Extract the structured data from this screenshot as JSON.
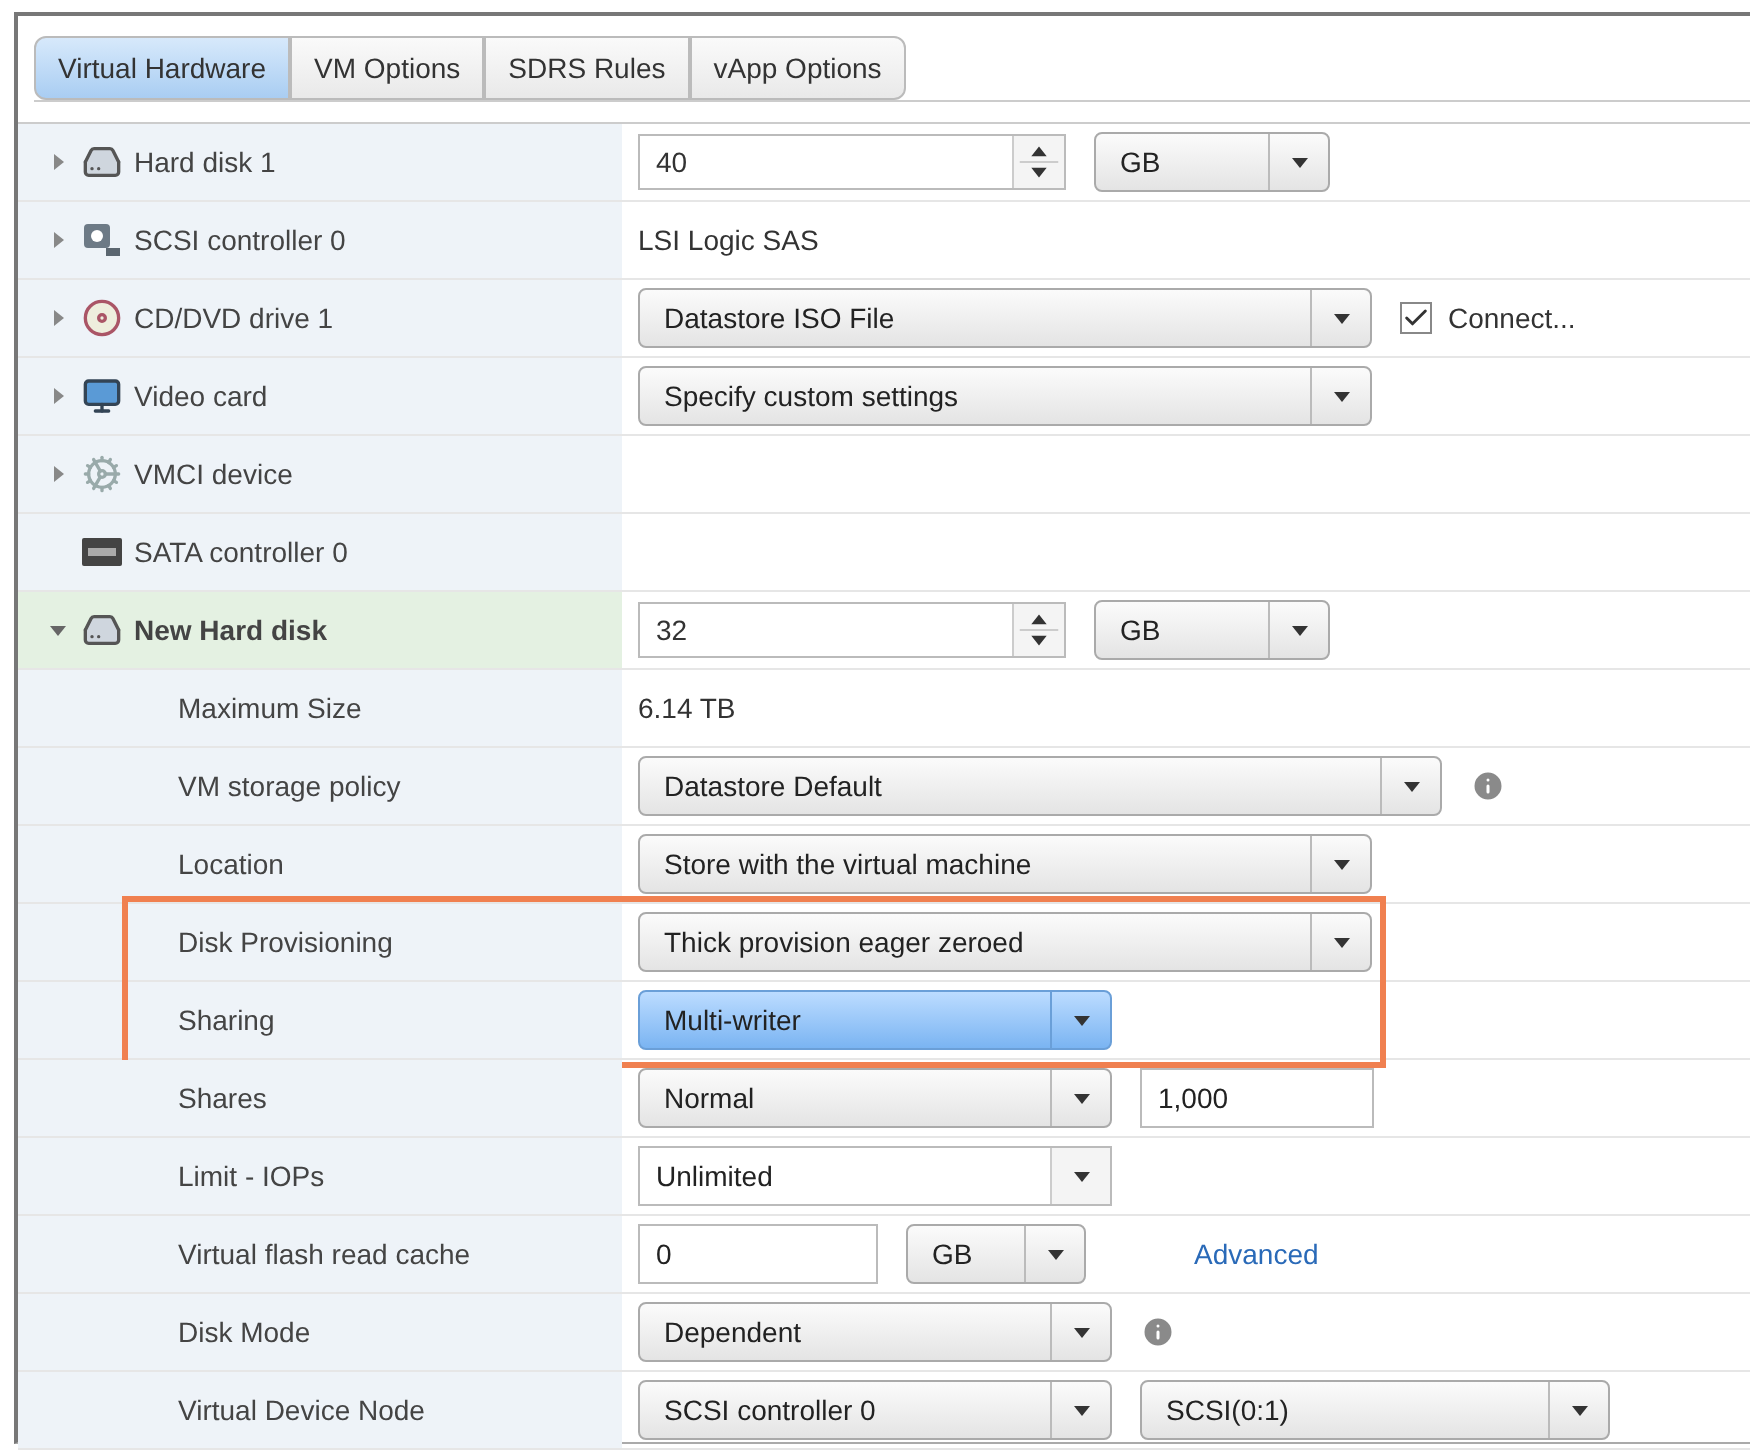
{
  "tabs": [
    {
      "label": "Virtual Hardware",
      "selected": true
    },
    {
      "label": "VM Options",
      "selected": false
    },
    {
      "label": "SDRS Rules",
      "selected": false
    },
    {
      "label": "vApp Options",
      "selected": false
    }
  ],
  "devices": [
    {
      "label": "Hard disk 1",
      "expanded": false,
      "controls": [
        {
          "kind": "spinner",
          "value": "40"
        },
        {
          "kind": "select",
          "value": "GB",
          "focused": false
        }
      ]
    },
    {
      "label": "SCSI controller 0",
      "expanded": false,
      "controls": [
        {
          "kind": "text",
          "value": "LSI Logic SAS"
        }
      ]
    },
    {
      "label": "CD/DVD drive 1",
      "expanded": false,
      "controls": [
        {
          "kind": "select",
          "value": "Datastore ISO File",
          "focused": false
        },
        {
          "kind": "checkbox",
          "label": "Connect...",
          "checked": true
        }
      ]
    },
    {
      "label": "Video card",
      "expanded": false,
      "controls": [
        {
          "kind": "select",
          "value": "Specify custom settings",
          "focused": false
        }
      ]
    },
    {
      "label": "VMCI device",
      "expanded": false
    },
    {
      "label": "SATA controller 0"
    },
    {
      "label": "New Hard disk",
      "expanded": true,
      "controls": [
        {
          "kind": "spinner",
          "value": "32"
        },
        {
          "kind": "select",
          "value": "GB",
          "focused": false
        }
      ],
      "children": [
        {
          "label": "Maximum Size",
          "highlighted": false,
          "controls": [
            {
              "kind": "text",
              "value": "6.14 TB"
            }
          ]
        },
        {
          "label": "VM storage policy",
          "highlighted": false,
          "controls": [
            {
              "kind": "select",
              "value": "Datastore Default",
              "focused": false
            },
            {
              "kind": "info"
            }
          ]
        },
        {
          "label": "Location",
          "highlighted": false,
          "controls": [
            {
              "kind": "select",
              "value": "Store with the virtual machine",
              "focused": false
            }
          ]
        },
        {
          "label": "Disk Provisioning",
          "highlighted": true,
          "controls": [
            {
              "kind": "select",
              "value": "Thick provision eager zeroed",
              "focused": false
            }
          ]
        },
        {
          "label": "Sharing",
          "highlighted": true,
          "controls": [
            {
              "kind": "select",
              "value": "Multi-writer",
              "focused": true
            }
          ]
        },
        {
          "label": "Shares",
          "highlighted": false,
          "controls": [
            {
              "kind": "select",
              "value": "Normal",
              "focused": false
            },
            {
              "kind": "input",
              "value": "1,000"
            }
          ]
        },
        {
          "label": "Limit - IOPs",
          "highlighted": false,
          "controls": [
            {
              "kind": "combo",
              "value": "Unlimited"
            }
          ]
        },
        {
          "label": "Virtual flash read cache",
          "highlighted": false,
          "controls": [
            {
              "kind": "input",
              "value": "0"
            },
            {
              "kind": "select",
              "value": "GB",
              "focused": false
            },
            {
              "kind": "link",
              "value": "Advanced"
            }
          ]
        },
        {
          "label": "Disk Mode",
          "highlighted": false,
          "controls": [
            {
              "kind": "select",
              "value": "Dependent",
              "focused": false
            },
            {
              "kind": "info"
            }
          ]
        },
        {
          "label": "Virtual Device Node",
          "highlighted": false,
          "controls": [
            {
              "kind": "select",
              "value": "SCSI controller 0",
              "focused": false
            },
            {
              "kind": "select",
              "value": "SCSI(0:1)",
              "focused": false
            }
          ]
        }
      ]
    }
  ]
}
